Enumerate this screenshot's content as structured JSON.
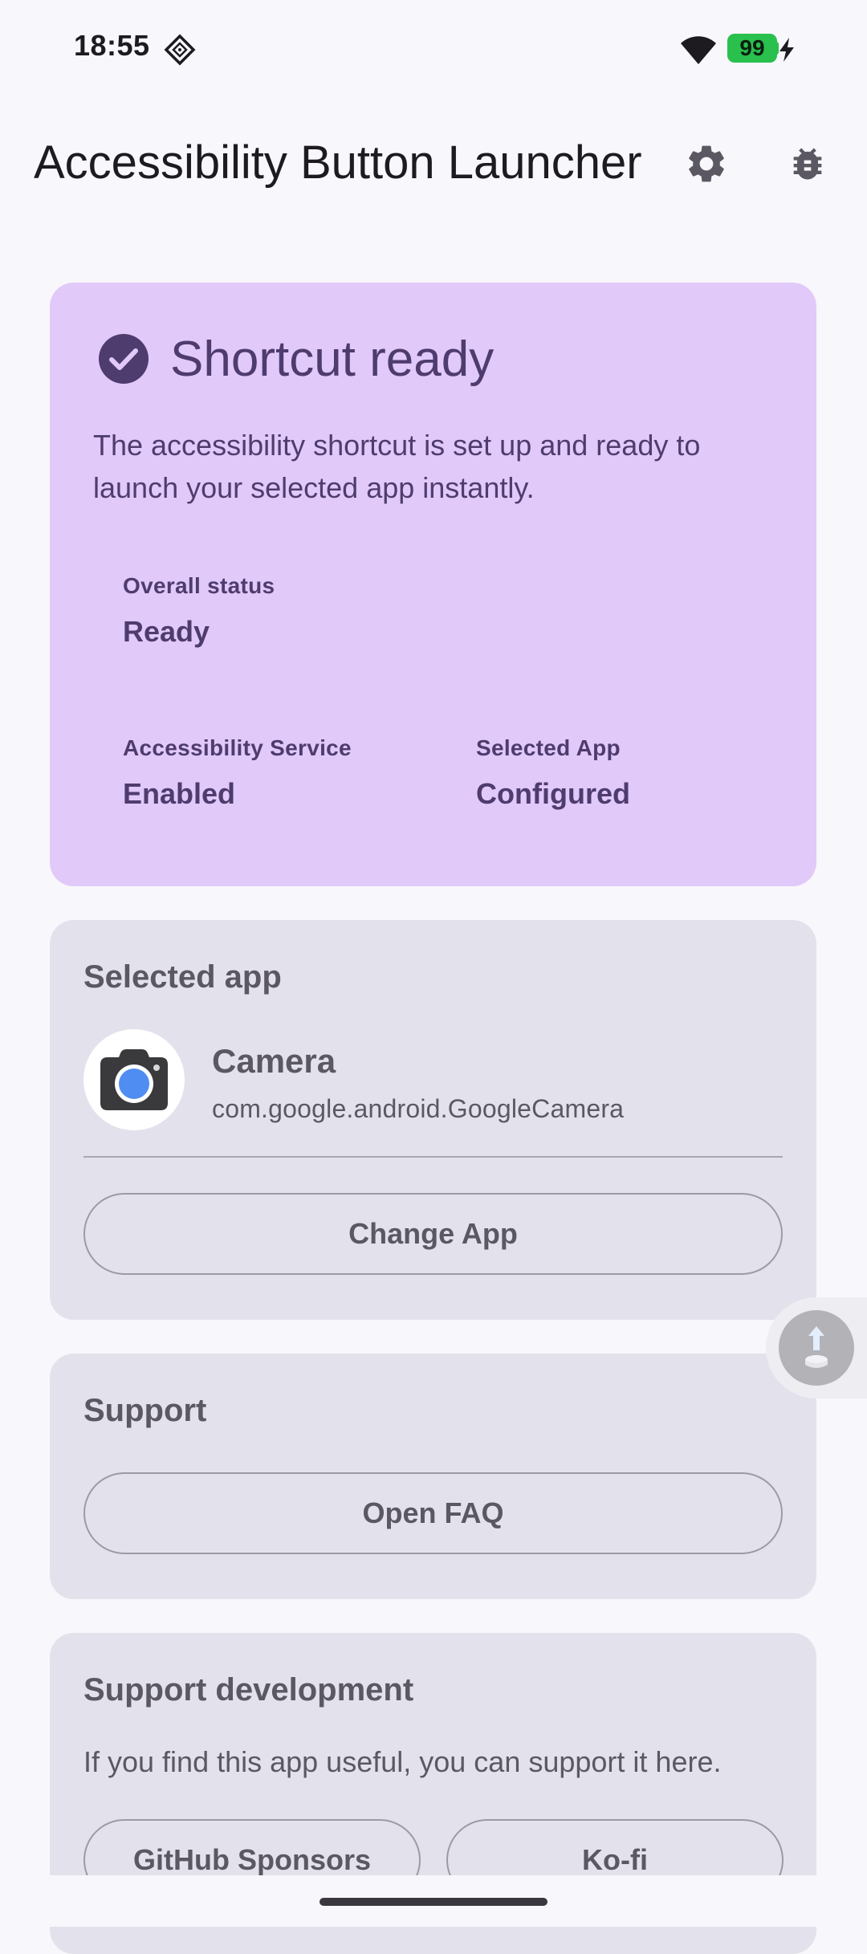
{
  "status_bar": {
    "time": "18:55",
    "battery": "99"
  },
  "app_bar": {
    "title": "Accessibility Button Launcher"
  },
  "status_card": {
    "title": "Shortcut ready",
    "description": "The accessibility shortcut is set up and ready to launch your selected app instantly.",
    "overall_label": "Overall status",
    "overall_value": "Ready",
    "service_label": "Accessibility Service",
    "service_value": "Enabled",
    "app_label": "Selected App",
    "app_value": "Configured"
  },
  "selected_app": {
    "heading": "Selected app",
    "app_name": "Camera",
    "package": "com.google.android.GoogleCamera",
    "change_button": "Change App"
  },
  "support": {
    "heading": "Support",
    "faq_button": "Open FAQ"
  },
  "support_development": {
    "heading": "Support development",
    "description": "If you find this app useful, you can support it here.",
    "github_button": "GitHub Sponsors",
    "kofi_button": "Ko-fi"
  },
  "colors": {
    "status_card_bg": "#e1c9fa",
    "status_text": "#4f3c6f",
    "card_bg": "#e3e2ec",
    "battery": "#29c04e",
    "camera_lens": "#4f8df2"
  },
  "icons": {
    "settings": "gear-icon",
    "debug": "bug-icon",
    "status": "check-circle-icon",
    "app": "camera-icon",
    "floating": "accessibility-icon"
  }
}
